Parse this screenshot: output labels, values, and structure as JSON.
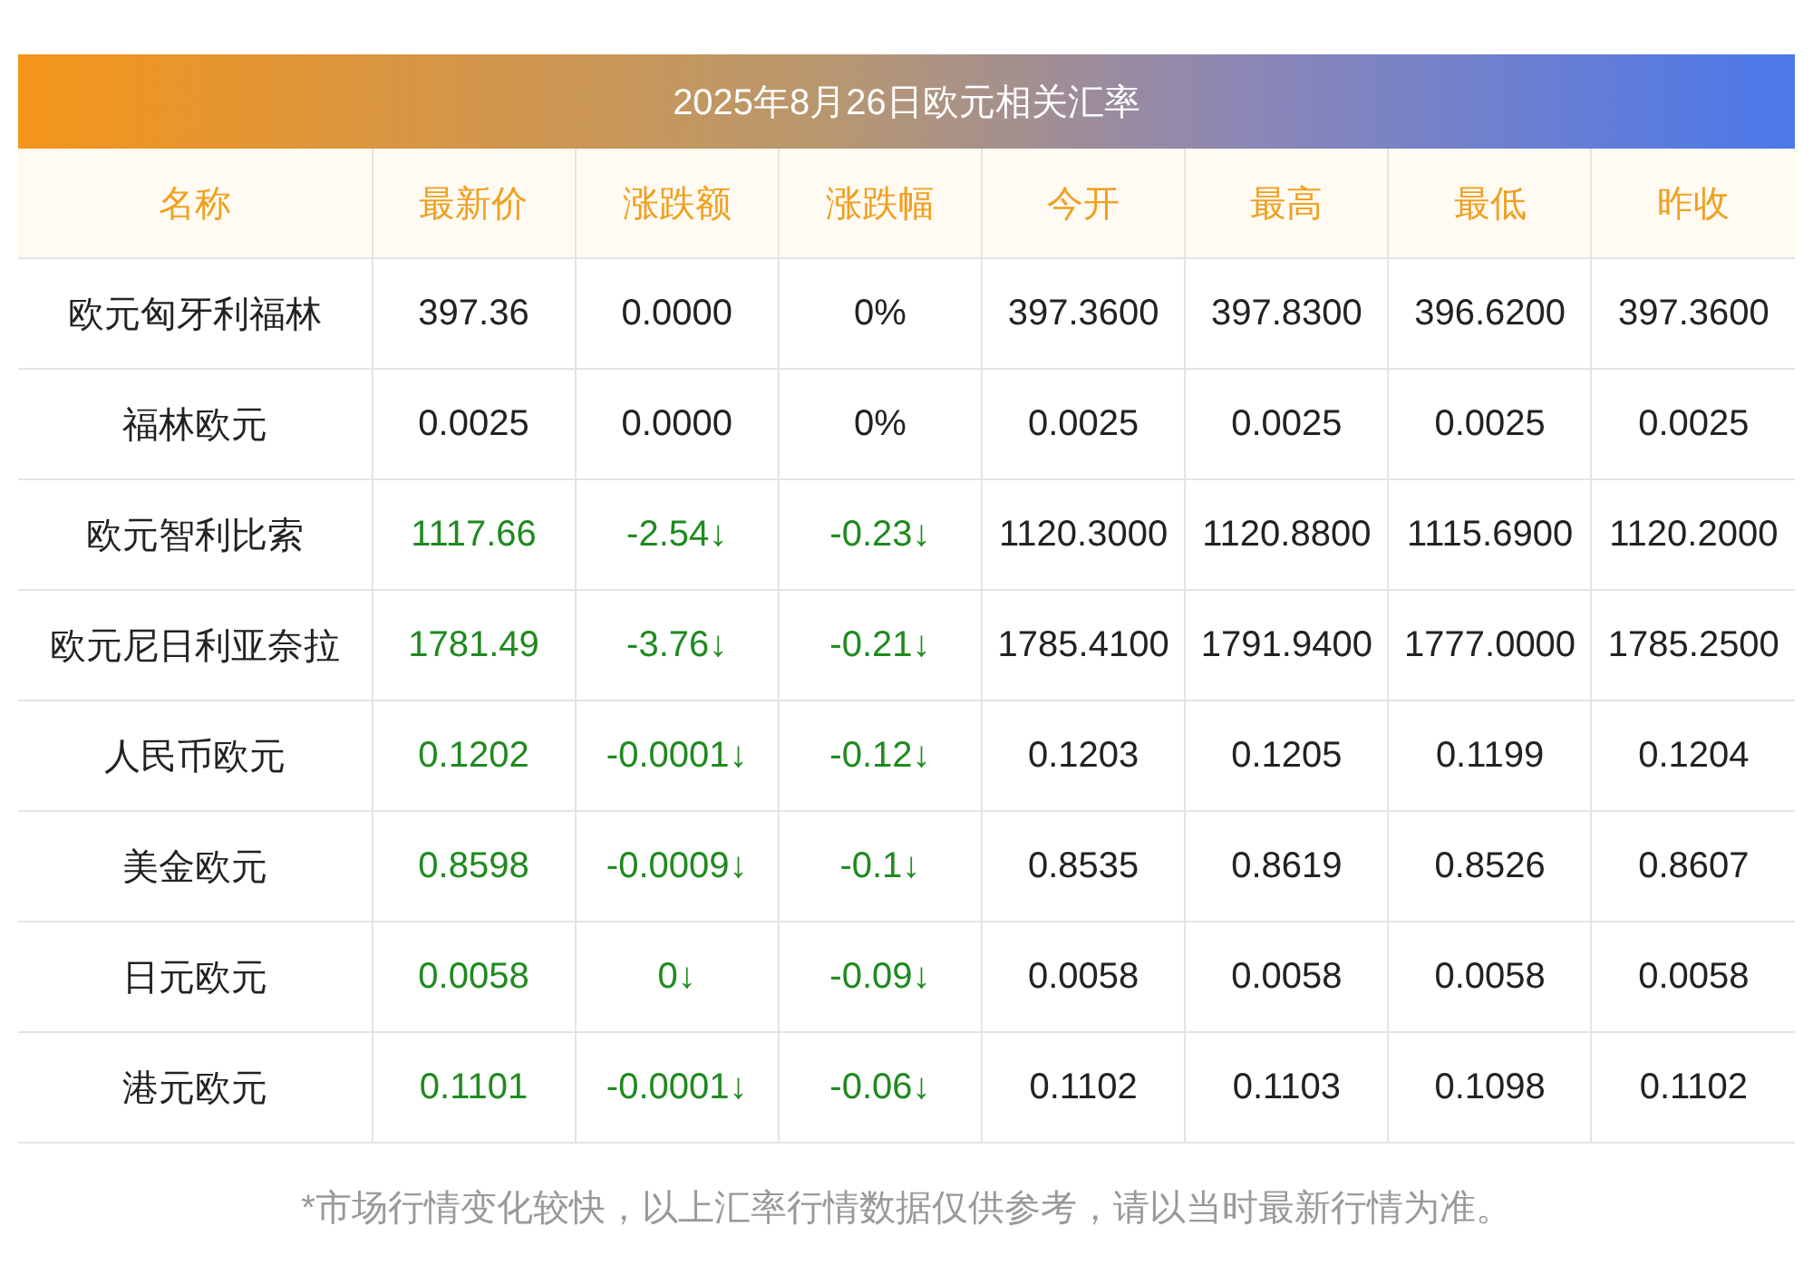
{
  "title": "2025年8月26日欧元相关汇率",
  "columns": [
    "名称",
    "最新价",
    "涨跌额",
    "涨跌幅",
    "今开",
    "最高",
    "最低",
    "昨收"
  ],
  "rows": [
    {
      "falling": false,
      "cells": [
        "欧元匈牙利福林",
        "397.36",
        "0.0000",
        "0%",
        "397.3600",
        "397.8300",
        "396.6200",
        "397.3600"
      ]
    },
    {
      "falling": false,
      "cells": [
        "福林欧元",
        "0.0025",
        "0.0000",
        "0%",
        "0.0025",
        "0.0025",
        "0.0025",
        "0.0025"
      ]
    },
    {
      "falling": true,
      "cells": [
        "欧元智利比索",
        "1117.66",
        "-2.54↓",
        "-0.23↓",
        "1120.3000",
        "1120.8800",
        "1115.6900",
        "1120.2000"
      ]
    },
    {
      "falling": true,
      "cells": [
        "欧元尼日利亚奈拉",
        "1781.49",
        "-3.76↓",
        "-0.21↓",
        "1785.4100",
        "1791.9400",
        "1777.0000",
        "1785.2500"
      ]
    },
    {
      "falling": true,
      "cells": [
        "人民币欧元",
        "0.1202",
        "-0.0001↓",
        "-0.12↓",
        "0.1203",
        "0.1205",
        "0.1199",
        "0.1204"
      ]
    },
    {
      "falling": true,
      "cells": [
        "美金欧元",
        "0.8598",
        "-0.0009↓",
        "-0.1↓",
        "0.8535",
        "0.8619",
        "0.8526",
        "0.8607"
      ]
    },
    {
      "falling": true,
      "cells": [
        "日元欧元",
        "0.0058",
        "0↓",
        "-0.09↓",
        "0.0058",
        "0.0058",
        "0.0058",
        "0.0058"
      ]
    },
    {
      "falling": true,
      "cells": [
        "港元欧元",
        "0.1101",
        "-0.0001↓",
        "-0.06↓",
        "0.1102",
        "0.1103",
        "0.1098",
        "0.1102"
      ]
    }
  ],
  "footnote": "*市场行情变化较快，以上汇率行情数据仅供参考，请以当时最新行情为准。"
}
